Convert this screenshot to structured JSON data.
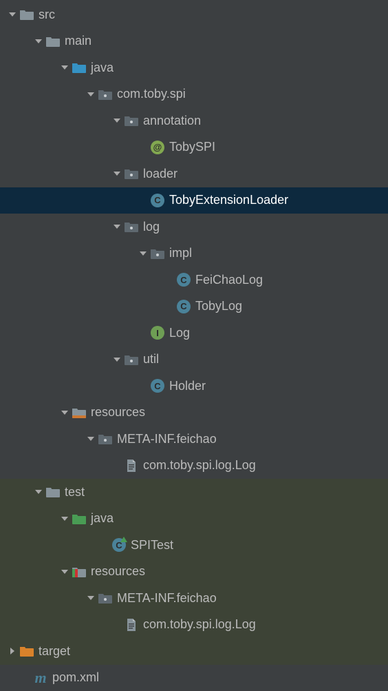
{
  "tree": [
    {
      "depth": 0,
      "arrow": "down",
      "icon": "folder-gray",
      "label": "src"
    },
    {
      "depth": 1,
      "arrow": "down",
      "icon": "folder-gray",
      "label": "main"
    },
    {
      "depth": 2,
      "arrow": "down",
      "icon": "folder-blue",
      "label": "java"
    },
    {
      "depth": 3,
      "arrow": "down",
      "icon": "package",
      "label": "com.toby.spi"
    },
    {
      "depth": 4,
      "arrow": "down",
      "icon": "package",
      "label": "annotation"
    },
    {
      "depth": 5,
      "arrow": "none",
      "icon": "anno",
      "label": "TobySPI"
    },
    {
      "depth": 4,
      "arrow": "down",
      "icon": "package",
      "label": "loader"
    },
    {
      "depth": 5,
      "arrow": "none",
      "icon": "class",
      "label": "TobyExtensionLoader",
      "selected": true
    },
    {
      "depth": 4,
      "arrow": "down",
      "icon": "package",
      "label": "log"
    },
    {
      "depth": 5,
      "arrow": "down",
      "icon": "package",
      "label": "impl"
    },
    {
      "depth": 6,
      "arrow": "none",
      "icon": "class",
      "label": "FeiChaoLog"
    },
    {
      "depth": 6,
      "arrow": "none",
      "icon": "class",
      "label": "TobyLog"
    },
    {
      "depth": 5,
      "arrow": "none",
      "icon": "interface",
      "label": "Log"
    },
    {
      "depth": 4,
      "arrow": "down",
      "icon": "package",
      "label": "util"
    },
    {
      "depth": 5,
      "arrow": "none",
      "icon": "class",
      "label": "Holder"
    },
    {
      "depth": 2,
      "arrow": "down",
      "icon": "res-folder",
      "label": "resources"
    },
    {
      "depth": 3,
      "arrow": "down",
      "icon": "package",
      "label": "META-INF.feichao"
    },
    {
      "depth": 4,
      "arrow": "none",
      "icon": "file",
      "label": "com.toby.spi.log.Log"
    },
    {
      "depth": 1,
      "arrow": "down",
      "icon": "folder-gray",
      "label": "test",
      "stripe": true
    },
    {
      "depth": 2,
      "arrow": "down",
      "icon": "folder-green",
      "label": "java",
      "stripe": true
    },
    {
      "depth": 3,
      "arrow": "none",
      "icon": "class-run",
      "label": "SPITest",
      "stripe": true,
      "depthPad": 1
    },
    {
      "depth": 2,
      "arrow": "down",
      "icon": "res-folder-test",
      "label": "resources",
      "stripe": true
    },
    {
      "depth": 3,
      "arrow": "down",
      "icon": "package",
      "label": "META-INF.feichao",
      "stripe": true
    },
    {
      "depth": 4,
      "arrow": "none",
      "icon": "file",
      "label": "com.toby.spi.log.Log",
      "stripe": true
    },
    {
      "depth": 0,
      "arrow": "right",
      "icon": "folder-orange",
      "label": "target",
      "stripe": true
    },
    {
      "depth": 0,
      "arrow": "none",
      "icon": "maven",
      "label": "pom.xml",
      "depthPad": 1
    }
  ]
}
